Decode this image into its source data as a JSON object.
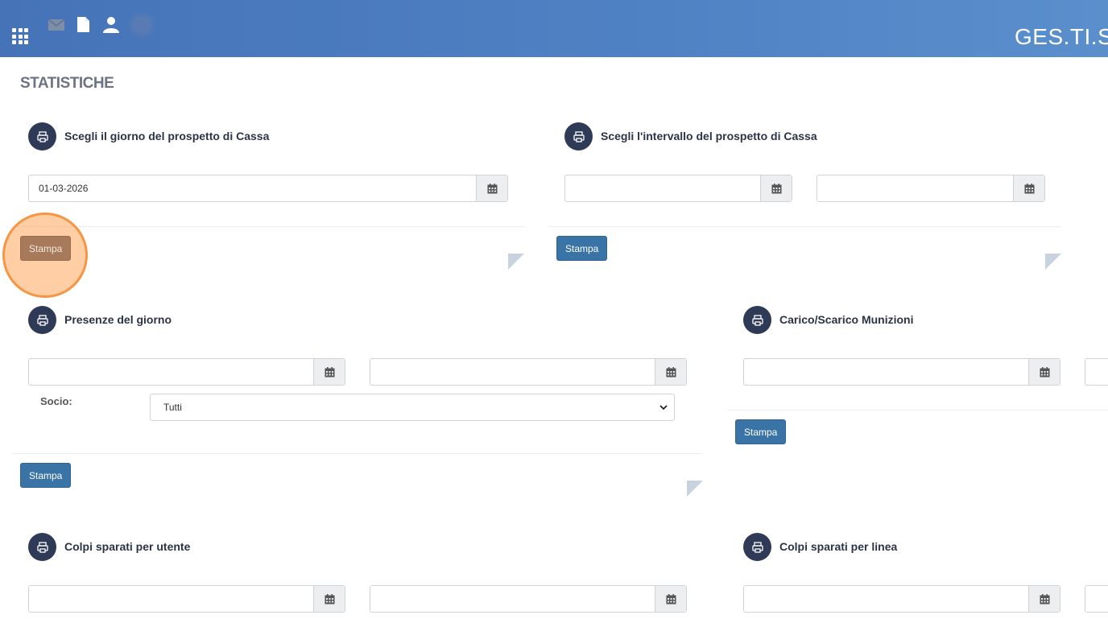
{
  "header": {
    "brand": "GES.TI.S"
  },
  "page": {
    "title": "STATISTICHE"
  },
  "panels": {
    "cassa_giorno": {
      "title": "Scegli il giorno del prospetto di Cassa",
      "date_value": "01-03-2026",
      "button": "Stampa"
    },
    "cassa_intervallo": {
      "title": "Scegli l'intervallo del prospetto di Cassa",
      "button": "Stampa"
    },
    "presenze": {
      "title": "Presenze del giorno",
      "socio_label": "Socio:",
      "socio_selected": "Tutti",
      "button": "Stampa"
    },
    "munizioni": {
      "title": "Carico/Scarico Munizioni",
      "button": "Stampa"
    },
    "colpi_utente": {
      "title": "Colpi sparati per utente"
    },
    "colpi_linea": {
      "title": "Colpi sparati per linea"
    }
  },
  "colors": {
    "header": "#4f82c4",
    "icon_circle": "#2f3b56",
    "button": "#3a74a6"
  }
}
